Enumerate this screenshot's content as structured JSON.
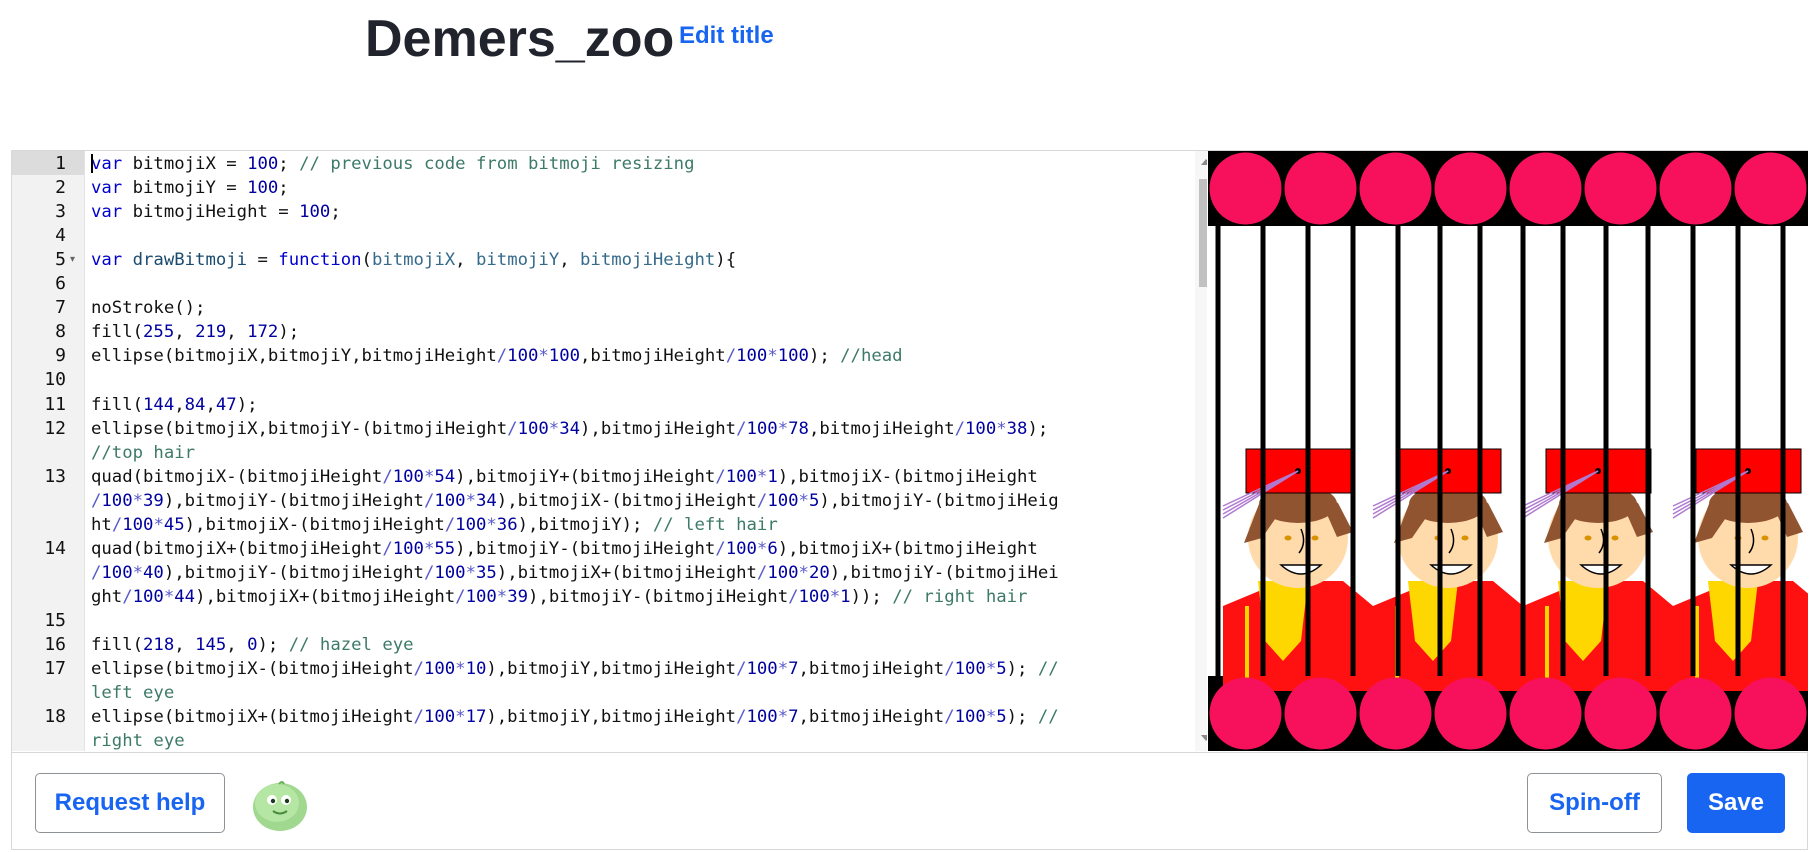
{
  "page": {
    "title": "Demers_zoo",
    "edit_title_label": "Edit title"
  },
  "editor": {
    "lines": [
      {
        "n": "1",
        "fold": "",
        "tokens": [
          [
            "kw",
            "var"
          ],
          [
            "p",
            " bitmojiX = "
          ],
          [
            "num",
            "100"
          ],
          [
            "p",
            "; "
          ],
          [
            "cm",
            "// previous code from bitmoji resizing"
          ]
        ]
      },
      {
        "n": "2",
        "fold": "",
        "tokens": [
          [
            "kw",
            "var"
          ],
          [
            "p",
            " bitmojiY = "
          ],
          [
            "num",
            "100"
          ],
          [
            "p",
            ";"
          ]
        ]
      },
      {
        "n": "3",
        "fold": "",
        "tokens": [
          [
            "kw",
            "var"
          ],
          [
            "p",
            " bitmojiHeight = "
          ],
          [
            "num",
            "100"
          ],
          [
            "p",
            ";"
          ]
        ]
      },
      {
        "n": "4",
        "fold": "",
        "tokens": []
      },
      {
        "n": "5",
        "fold": "▾",
        "tokens": [
          [
            "kw",
            "var"
          ],
          [
            "p",
            " "
          ],
          [
            "fn",
            "drawBitmoji"
          ],
          [
            "p",
            " = "
          ],
          [
            "kw",
            "function"
          ],
          [
            "p",
            "("
          ],
          [
            "arg",
            "bitmojiX"
          ],
          [
            "p",
            ", "
          ],
          [
            "arg",
            "bitmojiY"
          ],
          [
            "p",
            ", "
          ],
          [
            "arg",
            "bitmojiHeight"
          ],
          [
            "p",
            "){"
          ]
        ]
      },
      {
        "n": "6",
        "fold": "",
        "tokens": []
      },
      {
        "n": "7",
        "fold": "",
        "tokens": [
          [
            "p",
            "noStroke();"
          ]
        ]
      },
      {
        "n": "8",
        "fold": "",
        "tokens": [
          [
            "p",
            "fill("
          ],
          [
            "num",
            "255"
          ],
          [
            "p",
            ", "
          ],
          [
            "num",
            "219"
          ],
          [
            "p",
            ", "
          ],
          [
            "num",
            "172"
          ],
          [
            "p",
            ");"
          ]
        ]
      },
      {
        "n": "9",
        "fold": "",
        "tokens": [
          [
            "p",
            "ellipse(bitmojiX,bitmojiY,bitmojiHeight"
          ],
          [
            "op",
            "/"
          ],
          [
            "num",
            "100"
          ],
          [
            "op",
            "*"
          ],
          [
            "num",
            "100"
          ],
          [
            "p",
            ",bitmojiHeight"
          ],
          [
            "op",
            "/"
          ],
          [
            "num",
            "100"
          ],
          [
            "op",
            "*"
          ],
          [
            "num",
            "100"
          ],
          [
            "p",
            "); "
          ],
          [
            "cm",
            "//head"
          ]
        ]
      },
      {
        "n": "10",
        "fold": "",
        "tokens": []
      },
      {
        "n": "11",
        "fold": "",
        "tokens": [
          [
            "p",
            "fill("
          ],
          [
            "num",
            "144"
          ],
          [
            "p",
            ","
          ],
          [
            "num",
            "84"
          ],
          [
            "p",
            ","
          ],
          [
            "num",
            "47"
          ],
          [
            "p",
            ");"
          ]
        ]
      },
      {
        "n": "12",
        "fold": "",
        "tokens": [
          [
            "p",
            "ellipse(bitmojiX,bitmojiY-(bitmojiHeight"
          ],
          [
            "op",
            "/"
          ],
          [
            "num",
            "100"
          ],
          [
            "op",
            "*"
          ],
          [
            "num",
            "34"
          ],
          [
            "p",
            "),bitmojiHeight"
          ],
          [
            "op",
            "/"
          ],
          [
            "num",
            "100"
          ],
          [
            "op",
            "*"
          ],
          [
            "num",
            "78"
          ],
          [
            "p",
            ",bitmojiHeight"
          ],
          [
            "op",
            "/"
          ],
          [
            "num",
            "100"
          ],
          [
            "op",
            "*"
          ],
          [
            "num",
            "38"
          ],
          [
            "p",
            ");"
          ]
        ]
      },
      {
        "n": "",
        "fold": "",
        "tokens": [
          [
            "cm",
            "//top hair"
          ]
        ]
      },
      {
        "n": "13",
        "fold": "",
        "tokens": [
          [
            "p",
            "quad(bitmojiX-(bitmojiHeight"
          ],
          [
            "op",
            "/"
          ],
          [
            "num",
            "100"
          ],
          [
            "op",
            "*"
          ],
          [
            "num",
            "54"
          ],
          [
            "p",
            "),bitmojiY+(bitmojiHeight"
          ],
          [
            "op",
            "/"
          ],
          [
            "num",
            "100"
          ],
          [
            "op",
            "*"
          ],
          [
            "num",
            "1"
          ],
          [
            "p",
            "),bitmojiX-(bitmojiHeight"
          ]
        ]
      },
      {
        "n": "",
        "fold": "",
        "tokens": [
          [
            "op",
            "/"
          ],
          [
            "num",
            "100"
          ],
          [
            "op",
            "*"
          ],
          [
            "num",
            "39"
          ],
          [
            "p",
            "),bitmojiY-(bitmojiHeight"
          ],
          [
            "op",
            "/"
          ],
          [
            "num",
            "100"
          ],
          [
            "op",
            "*"
          ],
          [
            "num",
            "34"
          ],
          [
            "p",
            "),bitmojiX-(bitmojiHeight"
          ],
          [
            "op",
            "/"
          ],
          [
            "num",
            "100"
          ],
          [
            "op",
            "*"
          ],
          [
            "num",
            "5"
          ],
          [
            "p",
            "),bitmojiY-(bitmojiHeig"
          ]
        ]
      },
      {
        "n": "",
        "fold": "",
        "tokens": [
          [
            "p",
            "ht"
          ],
          [
            "op",
            "/"
          ],
          [
            "num",
            "100"
          ],
          [
            "op",
            "*"
          ],
          [
            "num",
            "45"
          ],
          [
            "p",
            "),bitmojiX-(bitmojiHeight"
          ],
          [
            "op",
            "/"
          ],
          [
            "num",
            "100"
          ],
          [
            "op",
            "*"
          ],
          [
            "num",
            "36"
          ],
          [
            "p",
            "),bitmojiY); "
          ],
          [
            "cm",
            "// left hair"
          ]
        ]
      },
      {
        "n": "14",
        "fold": "",
        "tokens": [
          [
            "p",
            "quad(bitmojiX+(bitmojiHeight"
          ],
          [
            "op",
            "/"
          ],
          [
            "num",
            "100"
          ],
          [
            "op",
            "*"
          ],
          [
            "num",
            "55"
          ],
          [
            "p",
            "),bitmojiY-(bitmojiHeight"
          ],
          [
            "op",
            "/"
          ],
          [
            "num",
            "100"
          ],
          [
            "op",
            "*"
          ],
          [
            "num",
            "6"
          ],
          [
            "p",
            "),bitmojiX+(bitmojiHeight"
          ]
        ]
      },
      {
        "n": "",
        "fold": "",
        "tokens": [
          [
            "op",
            "/"
          ],
          [
            "num",
            "100"
          ],
          [
            "op",
            "*"
          ],
          [
            "num",
            "40"
          ],
          [
            "p",
            "),bitmojiY-(bitmojiHeight"
          ],
          [
            "op",
            "/"
          ],
          [
            "num",
            "100"
          ],
          [
            "op",
            "*"
          ],
          [
            "num",
            "35"
          ],
          [
            "p",
            "),bitmojiX+(bitmojiHeight"
          ],
          [
            "op",
            "/"
          ],
          [
            "num",
            "100"
          ],
          [
            "op",
            "*"
          ],
          [
            "num",
            "20"
          ],
          [
            "p",
            "),bitmojiY-(bitmojiHei"
          ]
        ]
      },
      {
        "n": "",
        "fold": "",
        "tokens": [
          [
            "p",
            "ght"
          ],
          [
            "op",
            "/"
          ],
          [
            "num",
            "100"
          ],
          [
            "op",
            "*"
          ],
          [
            "num",
            "44"
          ],
          [
            "p",
            "),bitmojiX+(bitmojiHeight"
          ],
          [
            "op",
            "/"
          ],
          [
            "num",
            "100"
          ],
          [
            "op",
            "*"
          ],
          [
            "num",
            "39"
          ],
          [
            "p",
            "),bitmojiY-(bitmojiHeight"
          ],
          [
            "op",
            "/"
          ],
          [
            "num",
            "100"
          ],
          [
            "op",
            "*"
          ],
          [
            "num",
            "1"
          ],
          [
            "p",
            "));"
          ],
          [
            "p",
            " "
          ],
          [
            "cm",
            "// right hair"
          ]
        ]
      },
      {
        "n": "15",
        "fold": "",
        "tokens": []
      },
      {
        "n": "16",
        "fold": "",
        "tokens": [
          [
            "p",
            "fill("
          ],
          [
            "num",
            "218"
          ],
          [
            "p",
            ", "
          ],
          [
            "num",
            "145"
          ],
          [
            "p",
            ", "
          ],
          [
            "num",
            "0"
          ],
          [
            "p",
            "); "
          ],
          [
            "cm",
            "// hazel eye"
          ]
        ]
      },
      {
        "n": "17",
        "fold": "",
        "tokens": [
          [
            "p",
            "ellipse(bitmojiX-(bitmojiHeight"
          ],
          [
            "op",
            "/"
          ],
          [
            "num",
            "100"
          ],
          [
            "op",
            "*"
          ],
          [
            "num",
            "10"
          ],
          [
            "p",
            "),bitmojiY,bitmojiHeight"
          ],
          [
            "op",
            "/"
          ],
          [
            "num",
            "100"
          ],
          [
            "op",
            "*"
          ],
          [
            "num",
            "7"
          ],
          [
            "p",
            ",bitmojiHeight"
          ],
          [
            "op",
            "/"
          ],
          [
            "num",
            "100"
          ],
          [
            "op",
            "*"
          ],
          [
            "num",
            "5"
          ],
          [
            "p",
            "); "
          ],
          [
            "cm",
            "//"
          ]
        ]
      },
      {
        "n": "",
        "fold": "",
        "tokens": [
          [
            "cm",
            "left eye"
          ]
        ]
      },
      {
        "n": "18",
        "fold": "",
        "tokens": [
          [
            "p",
            "ellipse(bitmojiX+(bitmojiHeight"
          ],
          [
            "op",
            "/"
          ],
          [
            "num",
            "100"
          ],
          [
            "op",
            "*"
          ],
          [
            "num",
            "17"
          ],
          [
            "p",
            "),bitmojiY,bitmojiHeight"
          ],
          [
            "op",
            "/"
          ],
          [
            "num",
            "100"
          ],
          [
            "op",
            "*"
          ],
          [
            "num",
            "7"
          ],
          [
            "p",
            ",bitmojiHeight"
          ],
          [
            "op",
            "/"
          ],
          [
            "num",
            "100"
          ],
          [
            "op",
            "*"
          ],
          [
            "num",
            "5"
          ],
          [
            "p",
            "); "
          ],
          [
            "cm",
            "//"
          ]
        ]
      },
      {
        "n": "",
        "fold": "",
        "tokens": [
          [
            "cm",
            "right eye"
          ]
        ]
      }
    ],
    "colors": {
      "kw": "#0000cd",
      "fn": "#1a4b6e",
      "arg": "#356a8a",
      "num": "#0000a0",
      "op": "#5a5acd",
      "cm": "#3d7a68",
      "p": "#111111"
    }
  },
  "canvas": {
    "background": "#ffffff",
    "ball_color": "#f7115c",
    "bar_color": "#000000",
    "hat_color": "#ff0000",
    "skin_color": "#ffdbac",
    "hair_color": "#905430",
    "shirt_color": "#ff1111",
    "tie_color": "#ffd700",
    "eye_color": "#da9100"
  },
  "footer": {
    "request_help_label": "Request help",
    "spinoff_label": "Spin-off",
    "save_label": "Save"
  }
}
